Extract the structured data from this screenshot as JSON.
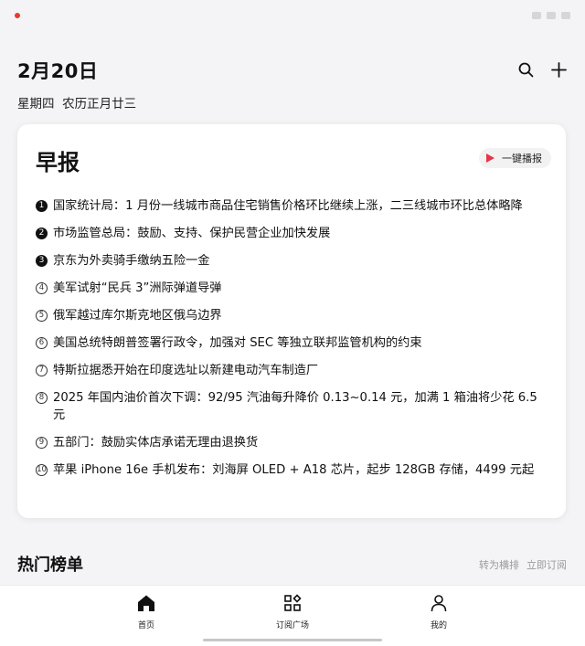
{
  "header": {
    "date": "2月20日",
    "weekday": "星期四",
    "lunar": "农历正月廿三"
  },
  "briefing": {
    "title": "早报",
    "play_label": "一键播报",
    "accent": "#e8334a",
    "items": [
      {
        "n": "1",
        "text": "国家统计局：1 月份一线城市商品住宅销售价格环比继续上涨，二三线城市环比总体略降"
      },
      {
        "n": "2",
        "text": "市场监管总局：鼓励、支持、保护民营企业加快发展"
      },
      {
        "n": "3",
        "text": "京东为外卖骑手缴纳五险一金"
      },
      {
        "n": "4",
        "text": "美军试射“民兵 3”洲际弹道导弹"
      },
      {
        "n": "5",
        "text": "俄军越过库尔斯克地区俄乌边界"
      },
      {
        "n": "6",
        "text": "美国总统特朗普签署行政令，加强对 SEC 等独立联邦监管机构的约束"
      },
      {
        "n": "7",
        "text": "特斯拉据悉开始在印度选址以新建电动汽车制造厂"
      },
      {
        "n": "8",
        "text": "2025 年国内油价首次下调：92/95 汽油每升降价 0.13~0.14 元，加满 1 箱油将少花 6.5 元"
      },
      {
        "n": "9",
        "text": "五部门：鼓励实体店承诺无理由退换货"
      },
      {
        "n": "10",
        "text": "苹果 iPhone 16e 手机发布：刘海屏 OLED + A18 芯片，起步 128GB 存储，4499 元起"
      }
    ]
  },
  "hot_section": {
    "title": "热门榜单",
    "action_1": "转为横排",
    "action_2": "立即订阅"
  },
  "tabs": {
    "home": "首页",
    "subscribe": "订阅广场",
    "me": "我的"
  },
  "icons": {
    "search": "search-icon",
    "add": "plus-icon",
    "play": "play-icon",
    "home": "home-icon",
    "apps": "apps-icon",
    "user": "user-icon"
  }
}
